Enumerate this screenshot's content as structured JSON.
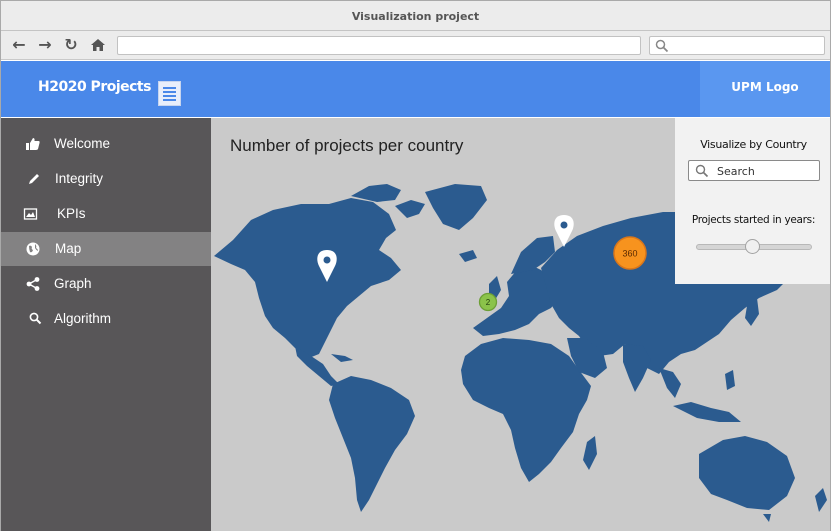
{
  "window": {
    "title": "Visualization project"
  },
  "browser": {
    "url": "",
    "search_placeholder": ""
  },
  "header": {
    "brand": "H2020 Projects",
    "logo": "UPM Logo",
    "menu_icon": "document-icon"
  },
  "sidebar": {
    "items": [
      {
        "label": "Welcome",
        "icon": "thumbs-up-icon",
        "active": false
      },
      {
        "label": "Integrity",
        "icon": "pen-icon",
        "active": false
      },
      {
        "label": "KPIs",
        "icon": "image-icon",
        "active": false
      },
      {
        "label": "Map",
        "icon": "globe-icon",
        "active": true
      },
      {
        "label": "Graph",
        "icon": "share-icon",
        "active": false
      },
      {
        "label": "Algorithm",
        "icon": "search-icon",
        "active": false
      }
    ]
  },
  "main": {
    "title": "Number of projects per country",
    "map": {
      "land_color": "#2b5b8f",
      "sea_color": "#cacaca",
      "markers": [
        {
          "kind": "pin",
          "region": "North America"
        },
        {
          "kind": "pin",
          "region": "Russia"
        },
        {
          "kind": "cluster",
          "label": "360",
          "color": "#f7931e"
        },
        {
          "kind": "cluster",
          "label": "2",
          "color": "#8bc34a"
        }
      ]
    },
    "filter_panel": {
      "title": "Visualize by Country",
      "search_placeholder": "Search",
      "years_label": "Projects started in years:",
      "slider_value": 0.5
    }
  },
  "colors": {
    "header": "#4a88e9",
    "logo_bg": "#5a97f0",
    "sidebar": "#585658",
    "sidebar_active": "#838283"
  }
}
